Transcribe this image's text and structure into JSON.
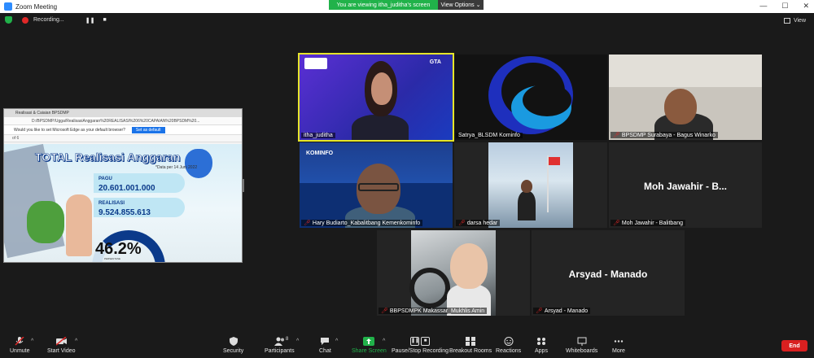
{
  "window": {
    "title": "Zoom Meeting"
  },
  "banner": {
    "viewing": "You are viewing itha_juditha's screen",
    "view_options": "View Options ⌄"
  },
  "recording": {
    "label": "Recording..."
  },
  "view_button": {
    "label": "View"
  },
  "shared_screen": {
    "tab_label": "Realisasi & Caiaian BPSDMP",
    "address": "D:/BPSDMP/Ugga/RealisasiAnggaran%20REALISASI%206%20CAPAIAN%20BPSDM%20...",
    "browser_prompt": "Would you like to set Microsoft Edge as your default browser?",
    "browser_prompt_button": "Set as default",
    "toolbar_text": "of 6",
    "slide_title": "TOTAL Realisasi Anggaran",
    "slide_date": "*Data per 14 Juni 2022",
    "pagu_label": "PAGU",
    "pagu_value": "20.601.001.000",
    "realisasi_label": "REALISASI",
    "realisasi_value": "9.524.855.613",
    "percentage": "46.2%",
    "percentage_caption": "PERSENTASE"
  },
  "participants": [
    {
      "name": "itha_juditha",
      "muted": false,
      "active": true
    },
    {
      "name": "Satrya_BLSDM Kominfo",
      "muted": false
    },
    {
      "name": "BPSDMP Surabaya - Bagus Winarko",
      "muted": true
    },
    {
      "name": "Hary Budiarto_Kabalitbang Kemenkominfo",
      "muted": true
    },
    {
      "name": "darsa hedar",
      "muted": true
    },
    {
      "name": "Moh Jawahir - Balitbang",
      "muted": true,
      "display_name": "Moh Jawahir - B..."
    },
    {
      "name": "BBPSDMPK Makassar_Mukhlis Amin",
      "muted": true
    },
    {
      "name": "Arsyad - Manado",
      "muted": true,
      "display_name": "Arsyad - Manado"
    }
  ],
  "tile_logo_text": {
    "gta": "GTA",
    "kominfo": "KOMINFO"
  },
  "toolbar": {
    "unmute": "Unmute",
    "start_video": "Start Video",
    "security": "Security",
    "participants": "Participants",
    "participants_count": "8",
    "chat": "Chat",
    "share_screen": "Share Screen",
    "pause_recording": "Pause/Stop Recording",
    "breakout_rooms": "Breakout Rooms",
    "reactions": "Reactions",
    "apps": "Apps",
    "whiteboards": "Whiteboards",
    "more": "More",
    "end": "End"
  },
  "colors": {
    "accent_green": "#21b24a",
    "end_red": "#d92020",
    "active_speaker": "#e6e62a",
    "kominfo_blue": "#0b3a8a"
  }
}
